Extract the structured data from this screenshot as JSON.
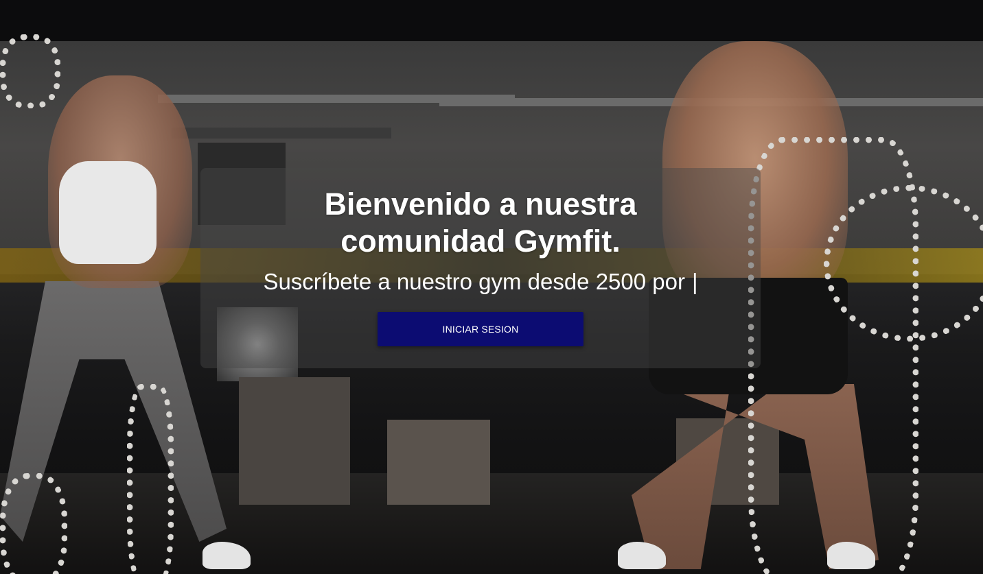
{
  "hero": {
    "title": "Bienvenido a nuestra comunidad Gymfit.",
    "subtitle": "Suscríbete a nuestro gym desde 2500 por",
    "cursor": "|",
    "login_button_label": "INICIAR SESION"
  },
  "colors": {
    "button_bg": "#0c0c72",
    "overlay_bg": "rgba(70,70,70,0.45)",
    "text": "#ffffff"
  }
}
